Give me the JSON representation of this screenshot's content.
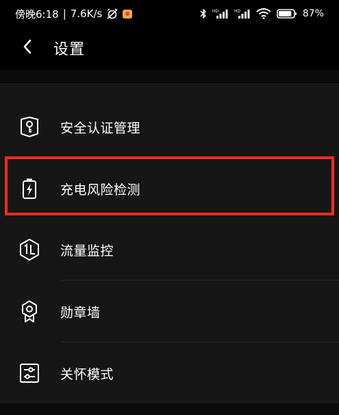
{
  "status_bar": {
    "time": "傍晚6:18",
    "separator": "|",
    "net_speed": "7.6K/s",
    "battery_percent": "87%",
    "battery_level": 87,
    "hd_label": "HD"
  },
  "header": {
    "title": "设置"
  },
  "menu": {
    "items": [
      {
        "label": "安全认证管理",
        "icon": "shield-key-icon"
      },
      {
        "label": "充电风险检测",
        "icon": "battery-charging-icon"
      },
      {
        "label": "流量监控",
        "icon": "traffic-hexagon-icon"
      },
      {
        "label": "勋章墙",
        "icon": "medal-icon"
      },
      {
        "label": "关怀模式",
        "icon": "sliders-icon"
      }
    ]
  },
  "colors": {
    "background": "#000000",
    "menu_background": "#161616",
    "highlight": "#ff2a1a",
    "text": "#ffffff"
  }
}
